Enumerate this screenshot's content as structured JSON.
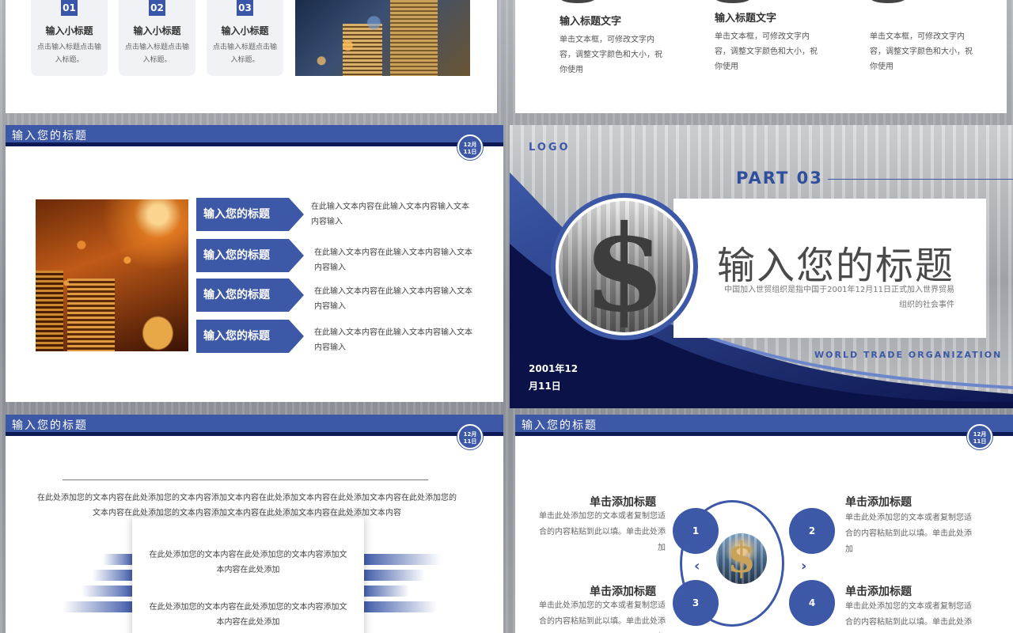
{
  "slide_a": {
    "cards": [
      {
        "num": "01",
        "title": "输入小标题",
        "desc": "点击输入标题点击输入标题。"
      },
      {
        "num": "02",
        "title": "输入小标题",
        "desc": "点击输入标题点击输入标题。"
      },
      {
        "num": "03",
        "title": "输入小标题",
        "desc": "点击输入标题点击输入标题。"
      }
    ]
  },
  "slide_b": {
    "cols": [
      {
        "title": "输入标题文字",
        "desc": "单击文本框，可修改文字内容，调整文字颜色和大小，祝你使用"
      },
      {
        "title": "输入标题文字",
        "desc": "单击文本框，可修改文字内容，调整文字颜色和大小，祝你使用"
      },
      {
        "title": "",
        "desc": "单击文本框，可修改文字内容，调整文字颜色和大小，祝你使用"
      }
    ]
  },
  "header": {
    "title": "输入您的标题",
    "date_line1": "12月",
    "date_line2": "11日"
  },
  "slide_c": {
    "items": [
      {
        "label": "输入您的标题",
        "desc": "在此输入文本内容在此输入文本内容输入文本内容输入"
      },
      {
        "label": "输入您的标题",
        "desc": "在此输入文本内容在此输入文本内容输入文本内容输入"
      },
      {
        "label": "输入您的标题",
        "desc": "在此输入文本内容在此输入文本内容输入文本内容输入"
      },
      {
        "label": "输入您的标题",
        "desc": "在此输入文本内容在此输入文本内容输入文本内容输入"
      }
    ]
  },
  "slide_d": {
    "logo": "LOGO",
    "part": "PART 03",
    "title": "输入您的标题",
    "subtitle": "中国加入世贸组织是指中国于2001年12月11日正式加入世界贸易组织的社会事件",
    "wto": "WORLD TRADE ORGANIZATION",
    "date_line1": "2001年12",
    "date_line2": "月11日",
    "symbol": "$"
  },
  "slide_e": {
    "paragraph": "在此处添加您的文本内容在此处添加您的文本内容添加文本内容在此处添加文本内容在此处添加文本内容在此处添加您的文本内容在此处添加您的文本内容添加文本内容在此处添加文本内容在此处添加文本内容",
    "card_text_1": "在此处添加您的文本内容在此处添加您的文本内容添加文本内容在此处添加",
    "card_text_2": "在此处添加您的文本内容在此处添加您的文本内容添加文本内容在此处添加"
  },
  "slide_f": {
    "items": [
      {
        "num": "1",
        "title": "单击添加标题",
        "desc": "单击此处添加您的文本或者复制您适合的内容粘贴到此以填。单击此处添加"
      },
      {
        "num": "2",
        "title": "单击添加标题",
        "desc": "单击此处添加您的文本或者复制您适合的内容粘贴到此以填。单击此处添加"
      },
      {
        "num": "3",
        "title": "单击添加标题",
        "desc": "单击此处添加您的文本或者复制您适合的内容粘贴到此以填。单击此处添加"
      },
      {
        "num": "4",
        "title": "单击添加标题",
        "desc": "单击此处添加您的文本或者复制您适合的内容粘贴到此以填。单击此处添加"
      }
    ],
    "center_symbol": "$",
    "chevron_left": "‹",
    "chevron_right": "›"
  },
  "colors": {
    "primary": "#3c58a7",
    "dark": "#0d1a55",
    "text": "#333333"
  }
}
